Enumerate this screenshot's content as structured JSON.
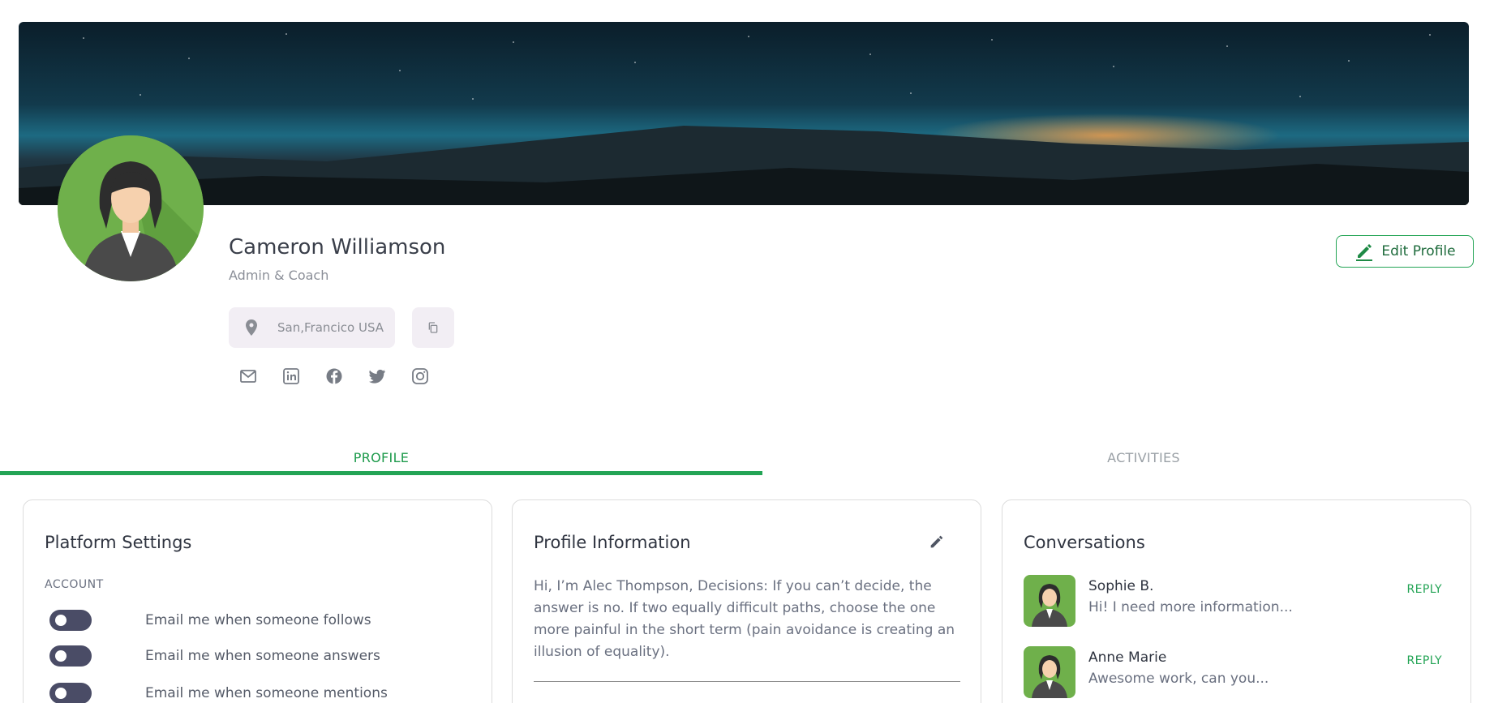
{
  "profile": {
    "name": "Cameron Williamson",
    "role": "Admin & Coach",
    "location": "San,Francico USA",
    "edit_label": "Edit Profile"
  },
  "socials": [
    {
      "icon": "mail-icon"
    },
    {
      "icon": "linkedin-icon"
    },
    {
      "icon": "facebook-icon"
    },
    {
      "icon": "twitter-icon"
    },
    {
      "icon": "instagram-icon"
    }
  ],
  "tabs": [
    {
      "label": "PROFILE",
      "active": true
    },
    {
      "label": "ACTIVITIES",
      "active": false
    }
  ],
  "platform_settings": {
    "title": "Platform Settings",
    "section": "ACCOUNT",
    "items": [
      {
        "label": "Email me when someone follows",
        "enabled": false
      },
      {
        "label": "Email me when someone answers",
        "enabled": false
      },
      {
        "label": "Email me when someone mentions",
        "enabled": false
      }
    ]
  },
  "profile_information": {
    "title": "Profile Information",
    "bio": "Hi, I’m Alec Thompson, Decisions: If you can’t decide, the answer is no. If two equally difficult paths, choose the one more painful in the short term (pain avoidance is creating an illusion of equality)."
  },
  "conversations": {
    "title": "Conversations",
    "items": [
      {
        "name": "Sophie B.",
        "message": "Hi! I need more information...",
        "action": "REPLY"
      },
      {
        "name": "Anne Marie",
        "message": "Awesome work, can you...",
        "action": "REPLY"
      }
    ]
  },
  "colors": {
    "accent": "#23a455",
    "toggle_off": "#4a4c66",
    "avatar_bg": "#6fb04b"
  }
}
